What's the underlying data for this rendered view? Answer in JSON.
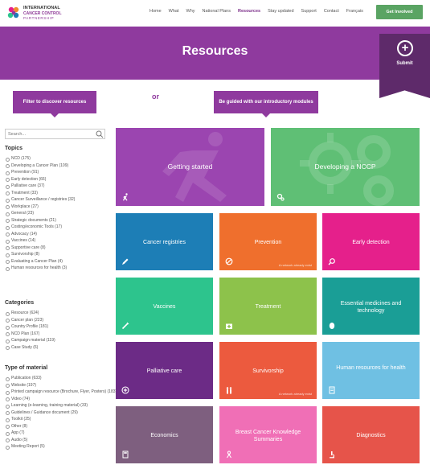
{
  "header": {
    "logo": {
      "line1": "INTERNATIONAL",
      "line2": "CANCER CONTROL",
      "line3": "PARTNERSHIP"
    },
    "nav": [
      {
        "label": "Home",
        "active": false
      },
      {
        "label": "What",
        "active": false
      },
      {
        "label": "Why",
        "active": false
      },
      {
        "label": "National Plans",
        "active": false
      },
      {
        "label": "Resources",
        "active": true
      },
      {
        "label": "Stay updated",
        "active": false
      },
      {
        "label": "Support",
        "active": false
      },
      {
        "label": "Contact",
        "active": false
      },
      {
        "label": "Français",
        "active": false
      }
    ],
    "cta_label": "Get Involved"
  },
  "banner": {
    "title": "Resources",
    "submit_label": "Submit"
  },
  "guides": {
    "filter_label": "Filter to discover resources",
    "or_label": "or",
    "modules_label": "Be guided with our introductory modules"
  },
  "sidebar": {
    "search_placeholder": "Search...",
    "topics_heading": "Topics",
    "topics": [
      "NCD (175)",
      "Developing a Cancer Plan (109)",
      "Prevention (91)",
      "Early detection (66)",
      "Palliative care (37)",
      "Treatment (33)",
      "Cancer Surveillance / registries (32)",
      "Workplace (27)",
      "General (23)",
      "Strategic documents (21)",
      "Costing/economic Tools (17)",
      "Advocacy (14)",
      "Vaccines (14)",
      "Supportive care (8)",
      "Survivorship (8)",
      "Evaluating a Cancer Plan (4)",
      "Human resources for health (3)"
    ],
    "categories_heading": "Categories",
    "categories": [
      "Resource (624)",
      "Cancer plan (223)",
      "Country Profile (181)",
      "NCD Plan (167)",
      "Campaign material (119)",
      "Case Study (6)"
    ],
    "material_heading": "Type of material",
    "materials": [
      "Publication (633)",
      "Website (197)",
      "Printed campaign resource (Brochure, Flyer, Posters) (183)",
      "Video (74)",
      "Learning (e-learning, training material) (33)",
      "Guidelines / Guidance document (29)",
      "Toolkit (25)",
      "Other (8)",
      "App (7)",
      "Audio (5)",
      "Meeting Report (5)"
    ]
  },
  "modules": {
    "getting_started": "Getting started",
    "developing_nccp": "Developing a NCCP"
  },
  "tiles": [
    {
      "label": "Cancer registries",
      "color": "#1d7eb6",
      "icon": "pencil-icon",
      "note": ""
    },
    {
      "label": "Prevention",
      "color": "#ef6f2d",
      "icon": "no-entry-icon",
      "note": "A network already exist"
    },
    {
      "label": "Early detection",
      "color": "#e5208b",
      "icon": "magnifier-icon",
      "note": ""
    },
    {
      "label": "Vaccines",
      "color": "#2dc48d",
      "icon": "syringe-icon",
      "note": ""
    },
    {
      "label": "Treatment",
      "color": "#8dc24b",
      "icon": "medical-kit-icon",
      "note": ""
    },
    {
      "label": "Essential medicines and technology",
      "color": "#1a9e96",
      "icon": "pill-icon",
      "note": ""
    },
    {
      "label": "Palliative care",
      "color": "#6c2b86",
      "icon": "plus-circle-icon",
      "note": ""
    },
    {
      "label": "Survivorship",
      "color": "#ec5a3e",
      "icon": "people-icon",
      "note": "A network already exist"
    },
    {
      "label": "Human resources for health",
      "color": "#6fc0e3",
      "icon": "document-icon",
      "note": ""
    },
    {
      "label": "Economics",
      "color": "#7e5f7f",
      "icon": "calculator-icon",
      "note": ""
    },
    {
      "label": "Breast Cancer Knowledge Summaries",
      "color": "#f06fb6",
      "icon": "ribbon-icon",
      "note": ""
    },
    {
      "label": "Diagnostics",
      "color": "#e6544a",
      "icon": "microscope-icon",
      "note": ""
    }
  ],
  "colors": {
    "brand_purple": "#8f3a9e",
    "submit_purple": "#5e2a6a",
    "cta_green": "#5aa463",
    "getting_started": "#9b45b0",
    "developing_nccp": "#5fbf75"
  }
}
